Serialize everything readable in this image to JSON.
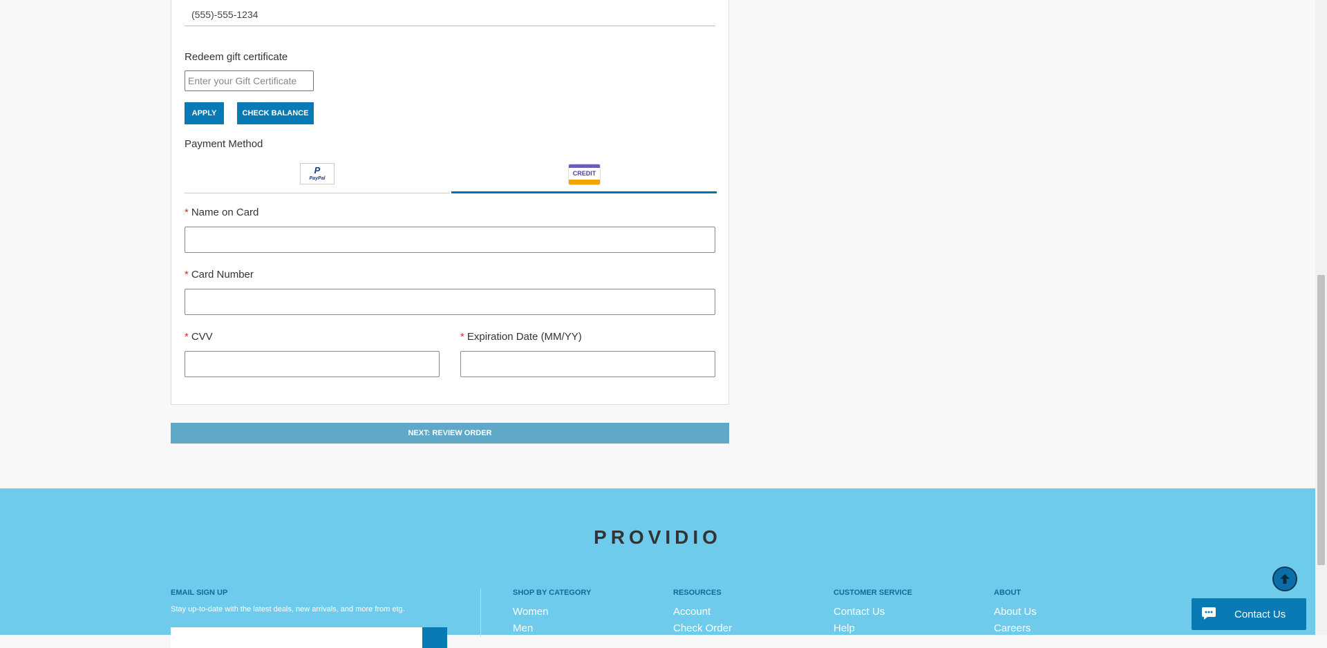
{
  "contact": {
    "phone_value": "(555)-555-1234"
  },
  "gift": {
    "label": "Redeem gift certificate",
    "placeholder": "Enter your Gift Certificate",
    "apply_label": "APPLY",
    "check_balance_label": "CHECK BALANCE"
  },
  "payment": {
    "label": "Payment Method",
    "paypal_logo_text": "PayPal",
    "paypal_logo_letter": "P",
    "credit_logo_text": "CREDIT",
    "selected_tab": "credit",
    "required_marker": "*",
    "name_label": "Name on Card",
    "number_label": "Card Number",
    "cvv_label": "CVV",
    "expiry_label": "Expiration Date (MM/YY)",
    "name_value": "",
    "number_value": "",
    "cvv_value": "",
    "expiry_value": ""
  },
  "next_button_label": "NEXT: REVIEW ORDER",
  "footer": {
    "brand": "PROVIDIO",
    "email_heading": "EMAIL SIGN UP",
    "email_text": "Stay up-to-date with the latest deals, new arrivals, and more from etg.",
    "columns": [
      {
        "heading": "SHOP BY CATEGORY",
        "links": [
          "Women",
          "Men"
        ]
      },
      {
        "heading": "RESOURCES",
        "links": [
          "Account",
          "Check Order"
        ]
      },
      {
        "heading": "CUSTOMER SERVICE",
        "links": [
          "Contact Us",
          "Help"
        ]
      },
      {
        "heading": "ABOUT",
        "links": [
          "About Us",
          "Careers"
        ]
      }
    ]
  },
  "chat": {
    "label": "Contact Us"
  },
  "colors": {
    "accent": "#0a7ab4",
    "footer_bg": "#6ecbec",
    "next_button": "#5fa8c8",
    "required": "#c0392b"
  },
  "icons": {
    "scroll_top": "arrow-up-circle-icon",
    "chat": "chat-bubble-icon"
  }
}
